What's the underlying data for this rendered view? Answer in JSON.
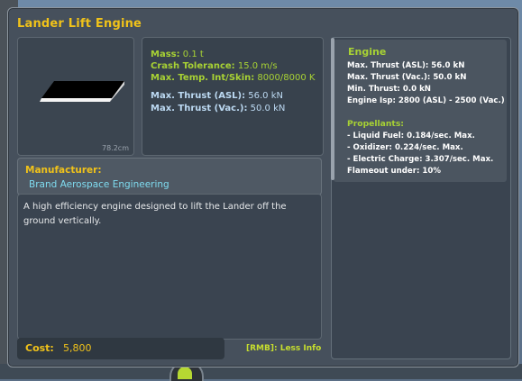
{
  "window": {
    "title": "Lander Lift Engine"
  },
  "thumbnail": {
    "size_label": "78.2cm"
  },
  "stats": {
    "mass_label": "Mass:",
    "mass_value": "0.1 t",
    "crash_label": "Crash Tolerance:",
    "crash_value": "15.0 m/s",
    "temp_label": "Max. Temp. Int/Skin:",
    "temp_value": "8000/8000 K",
    "thrust_asl_label": "Max. Thrust (ASL):",
    "thrust_asl_value": "56.0 kN",
    "thrust_vac_label": "Max. Thrust (Vac.):",
    "thrust_vac_value": "50.0 kN"
  },
  "manufacturer": {
    "label": "Manufacturer:",
    "name": "Brand Aerospace Engineering"
  },
  "description": {
    "text": "A high efficiency engine designed to lift the Lander off the ground vertically."
  },
  "cost": {
    "label": "Cost:",
    "value": "5,800"
  },
  "footer": {
    "rmb_hint": "[RMB]: Less Info"
  },
  "engine": {
    "title": "Engine",
    "lines": [
      "Max. Thrust (ASL): 56.0 kN",
      "Max. Thrust (Vac.): 50.0 kN",
      "Min. Thrust: 0.0 kN",
      "Engine Isp: 2800 (ASL) - 2500 (Vac.)"
    ],
    "propellants_title": "Propellants:",
    "propellants": [
      "- Liquid Fuel: 0.184/sec. Max.",
      "- Oxidizer: 0.224/sec. Max.",
      "- Electric Charge: 3.307/sec. Max.",
      "Flameout under: 10%"
    ]
  },
  "colors": {
    "title_yellow": "#f0c21a",
    "stat_green": "#a8d234",
    "stat_blue": "#bcd9f2",
    "manufacturer_cyan": "#7fdcf0"
  }
}
